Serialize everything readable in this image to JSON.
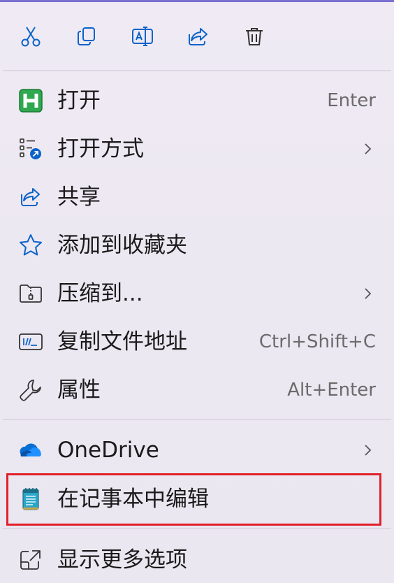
{
  "toolbar": {
    "icons": [
      "cut-icon",
      "copy-icon",
      "rename-icon",
      "share-icon",
      "delete-icon"
    ]
  },
  "menu": {
    "items": [
      {
        "label": "打开",
        "accel": "Enter",
        "icon": "app-h-icon"
      },
      {
        "label": "打开方式",
        "accel": "",
        "icon": "open-with-icon",
        "submenu": true
      },
      {
        "label": "共享",
        "accel": "",
        "icon": "share-icon"
      },
      {
        "label": "添加到收藏夹",
        "accel": "",
        "icon": "star-icon"
      },
      {
        "label": "压缩到...",
        "accel": "",
        "icon": "zip-folder-icon",
        "submenu": true
      },
      {
        "label": "复制文件地址",
        "accel": "Ctrl+Shift+C",
        "icon": "copy-path-icon"
      },
      {
        "label": "属性",
        "accel": "Alt+Enter",
        "icon": "wrench-icon"
      },
      {
        "label": "OneDrive",
        "accel": "",
        "icon": "onedrive-cloud-icon",
        "submenu": true
      },
      {
        "label": "在记事本中编辑",
        "accel": "",
        "icon": "notepad-icon",
        "highlighted": true
      },
      {
        "label": "显示更多选项",
        "accel": "",
        "icon": "show-more-icon"
      }
    ]
  },
  "colors": {
    "accent": "#0b63c9",
    "highlight_border": "#e0202a",
    "app_green": "#2fa84f"
  }
}
